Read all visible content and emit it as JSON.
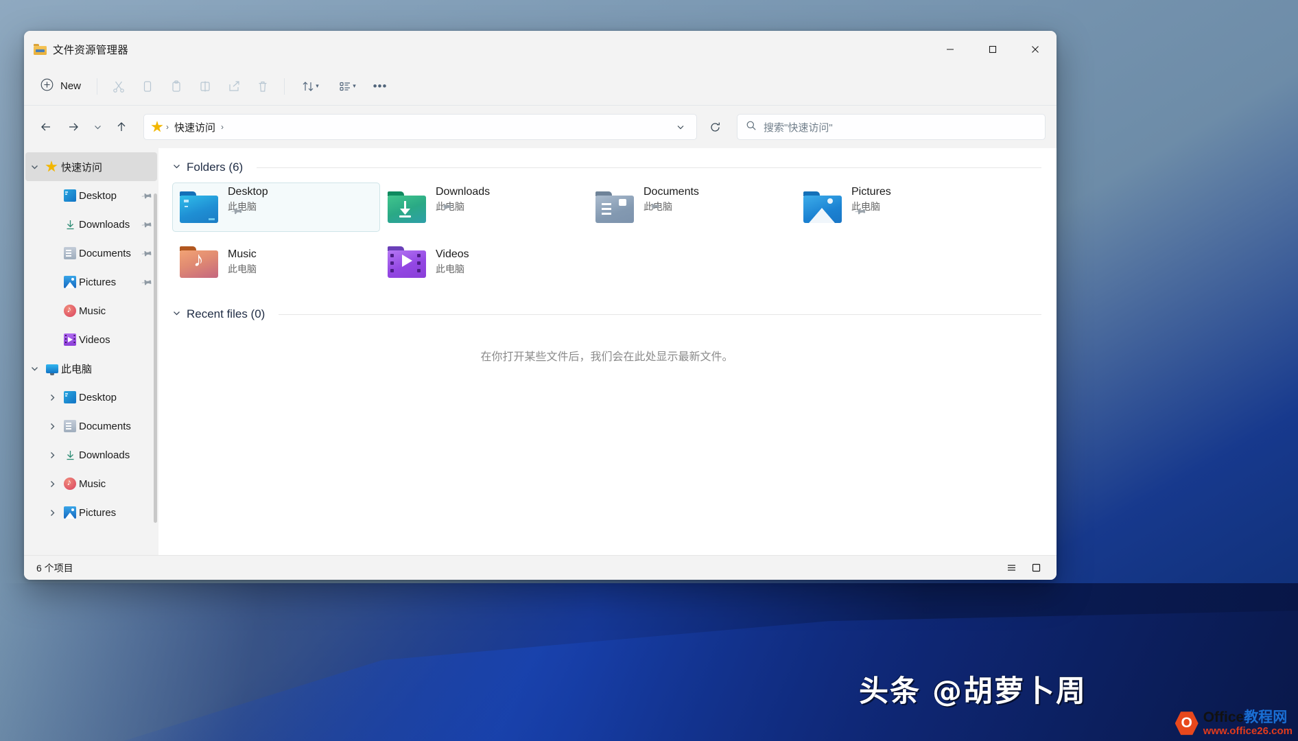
{
  "window": {
    "title": "文件资源管理器",
    "app_icon": "folder-icon",
    "controls": {
      "minimize": "—",
      "maximize": "☐",
      "close": "✕"
    }
  },
  "toolbar": {
    "new_label": "New",
    "new_icon": "plus-circle-icon",
    "buttons": [
      {
        "name": "cut",
        "icon": "scissors-icon",
        "enabled": false
      },
      {
        "name": "copy",
        "icon": "copy-icon",
        "enabled": false
      },
      {
        "name": "paste",
        "icon": "paste-icon",
        "enabled": false
      },
      {
        "name": "rename",
        "icon": "rename-icon",
        "enabled": false
      },
      {
        "name": "share",
        "icon": "share-icon",
        "enabled": false
      },
      {
        "name": "delete",
        "icon": "trash-icon",
        "enabled": false
      }
    ],
    "sort_icon": "sort-arrows-icon",
    "view_icon": "view-list-icon",
    "more_label": "•••"
  },
  "address": {
    "back_icon": "arrow-left-icon",
    "forward_icon": "arrow-right-icon",
    "recent_icon": "chevron-down-icon",
    "up_icon": "arrow-up-icon",
    "breadcrumb_icon": "star-icon",
    "breadcrumb": [
      "快速访问"
    ],
    "breadcrumb_separator": "›",
    "dropdown_icon": "chevron-down-icon",
    "refresh_icon": "refresh-icon"
  },
  "search": {
    "icon": "search-icon",
    "placeholder": "搜索\"快速访问\"",
    "value": ""
  },
  "sidebar": {
    "items": [
      {
        "label": "快速访问",
        "icon": "star-icon",
        "chevron": "⌄",
        "level": 0,
        "selected": true,
        "pinned": false
      },
      {
        "label": "Desktop",
        "icon": "desktop-icon",
        "chevron": "",
        "level": 1,
        "selected": false,
        "pinned": true
      },
      {
        "label": "Downloads",
        "icon": "download-icon",
        "chevron": "",
        "level": 1,
        "selected": false,
        "pinned": true
      },
      {
        "label": "Documents",
        "icon": "documents-icon",
        "chevron": "",
        "level": 1,
        "selected": false,
        "pinned": true
      },
      {
        "label": "Pictures",
        "icon": "pictures-icon",
        "chevron": "",
        "level": 1,
        "selected": false,
        "pinned": true
      },
      {
        "label": "Music",
        "icon": "music-icon",
        "chevron": "",
        "level": 1,
        "selected": false,
        "pinned": false
      },
      {
        "label": "Videos",
        "icon": "videos-icon",
        "chevron": "",
        "level": 1,
        "selected": false,
        "pinned": false
      },
      {
        "label": "此电脑",
        "icon": "this-pc-icon",
        "chevron": "⌄",
        "level": 0,
        "selected": false,
        "pinned": false
      },
      {
        "label": "Desktop",
        "icon": "desktop-icon",
        "chevron": "›",
        "level": 1,
        "selected": false,
        "pinned": false
      },
      {
        "label": "Documents",
        "icon": "documents-icon",
        "chevron": "›",
        "level": 1,
        "selected": false,
        "pinned": false
      },
      {
        "label": "Downloads",
        "icon": "download-icon",
        "chevron": "›",
        "level": 1,
        "selected": false,
        "pinned": false
      },
      {
        "label": "Music",
        "icon": "music-icon",
        "chevron": "›",
        "level": 1,
        "selected": false,
        "pinned": false
      },
      {
        "label": "Pictures",
        "icon": "pictures-icon",
        "chevron": "›",
        "level": 1,
        "selected": false,
        "pinned": false
      }
    ],
    "pin_glyph": "📌"
  },
  "content": {
    "folders_section": {
      "title": "Folders (6)",
      "chevron": "⌄",
      "items": [
        {
          "name": "Desktop",
          "sub": "此电脑",
          "icon": "folder-desktop-icon",
          "pinned": true,
          "selected": true
        },
        {
          "name": "Downloads",
          "sub": "此电脑",
          "icon": "folder-downloads-icon",
          "pinned": true,
          "selected": false
        },
        {
          "name": "Documents",
          "sub": "此电脑",
          "icon": "folder-documents-icon",
          "pinned": true,
          "selected": false
        },
        {
          "name": "Pictures",
          "sub": "此电脑",
          "icon": "folder-pictures-icon",
          "pinned": true,
          "selected": false
        },
        {
          "name": "Music",
          "sub": "此电脑",
          "icon": "folder-music-icon",
          "pinned": false,
          "selected": false
        },
        {
          "name": "Videos",
          "sub": "此电脑",
          "icon": "folder-videos-icon",
          "pinned": false,
          "selected": false
        }
      ]
    },
    "recent_section": {
      "title": "Recent files (0)",
      "chevron": "⌄",
      "empty_message": "在你打开某些文件后，我们会在此处显示最新文件。"
    }
  },
  "statusbar": {
    "item_count": "6 个项目",
    "details_view_icon": "details-view-icon",
    "large-icons_view_icon": "large-icons-view-icon"
  },
  "watermarks": {
    "toutiao": "头条 @胡萝卜周",
    "office_logo_letter": "O",
    "office_name_black": "Office",
    "office_name_blue": "教程网",
    "office_url": "www.office26.com"
  }
}
